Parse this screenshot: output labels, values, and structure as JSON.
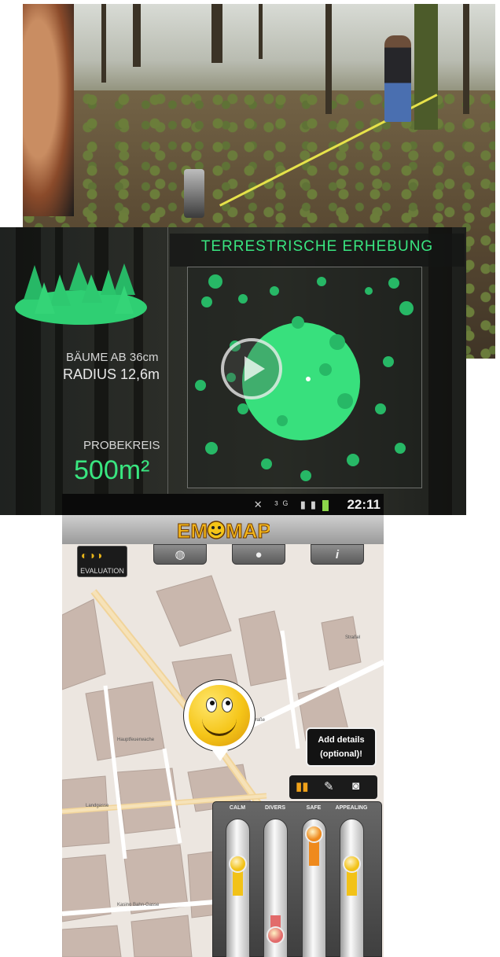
{
  "forest_panel": {
    "title": "TERRESTRISCHE ERHEBUNG",
    "trees_label": "BÄUME AB 36cm",
    "radius_label": "RADIUS 12,6m",
    "sample_label": "PROBEKREIS",
    "area_value": "500m²"
  },
  "statusbar": {
    "icons": "✕ ³ᴳ ▮▮",
    "time": "22:11"
  },
  "app": {
    "logo_text": "EMOMAP",
    "evaluation_label": "EVALUATION",
    "toolbar": [
      "globe-icon",
      "person-icon",
      "info-icon"
    ],
    "callout_line1": "Add details",
    "callout_line2": "(optional)!",
    "map_labels": [
      "Hauptfeuerwache",
      "Landgasse",
      "Kasino Bahn-Gasse",
      "Straße",
      "Straßel"
    ]
  },
  "sliders": [
    {
      "label": "CALM",
      "level": 0.72,
      "color": "#f2c218"
    },
    {
      "label": "DIVERS",
      "level": 0.1,
      "color": "#e26b6b"
    },
    {
      "label": "SAFE",
      "level": 0.98,
      "color": "#ef8a1d"
    },
    {
      "label": "APPEALING",
      "level": 0.72,
      "color": "#f2c218"
    }
  ],
  "colors": {
    "accent_green": "#39e680",
    "map_bg": "#ece6e0",
    "building": "#c9b7ad"
  }
}
